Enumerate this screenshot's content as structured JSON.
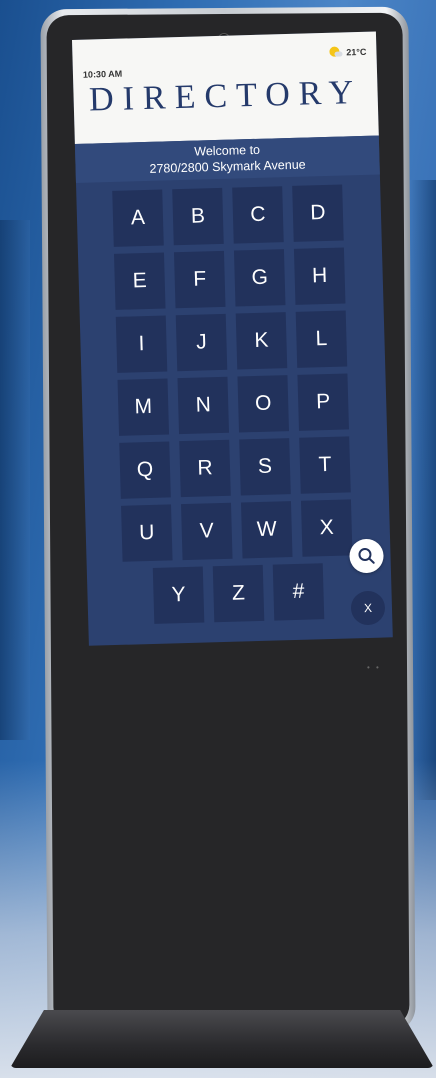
{
  "status": {
    "time": "10:30 AM",
    "temperature": "21°C",
    "weather_icon": "partly-sunny-icon"
  },
  "header": {
    "title": "DIRECTORY"
  },
  "welcome": {
    "line1": "Welcome to",
    "line2": "2780/2800 Skymark Avenue"
  },
  "keypad": {
    "keys": [
      "A",
      "B",
      "C",
      "D",
      "E",
      "F",
      "G",
      "H",
      "I",
      "J",
      "K",
      "L",
      "M",
      "N",
      "O",
      "P",
      "Q",
      "R",
      "S",
      "T",
      "U",
      "V",
      "W",
      "X"
    ],
    "last_row": [
      "Y",
      "Z",
      "#"
    ]
  },
  "actions": {
    "search_icon": "search-icon",
    "close_label": "X"
  },
  "colors": {
    "screen_bg": "#2c4170",
    "key_bg": "#22325c",
    "title": "#253a6b"
  }
}
